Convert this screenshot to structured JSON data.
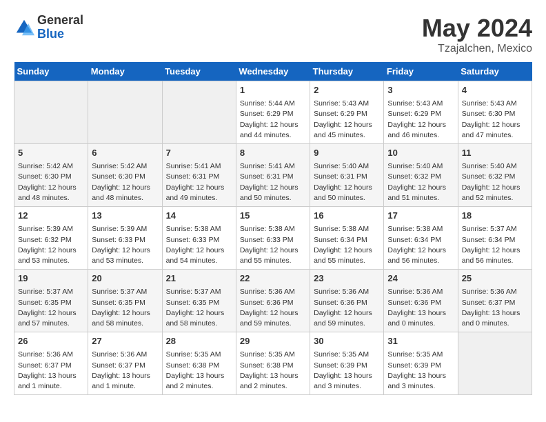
{
  "header": {
    "logo_general": "General",
    "logo_blue": "Blue",
    "month_title": "May 2024",
    "location": "Tzajalchen, Mexico"
  },
  "days_of_week": [
    "Sunday",
    "Monday",
    "Tuesday",
    "Wednesday",
    "Thursday",
    "Friday",
    "Saturday"
  ],
  "weeks": [
    [
      {
        "day": "",
        "info": ""
      },
      {
        "day": "",
        "info": ""
      },
      {
        "day": "",
        "info": ""
      },
      {
        "day": "1",
        "info": "Sunrise: 5:44 AM\nSunset: 6:29 PM\nDaylight: 12 hours\nand 44 minutes."
      },
      {
        "day": "2",
        "info": "Sunrise: 5:43 AM\nSunset: 6:29 PM\nDaylight: 12 hours\nand 45 minutes."
      },
      {
        "day": "3",
        "info": "Sunrise: 5:43 AM\nSunset: 6:29 PM\nDaylight: 12 hours\nand 46 minutes."
      },
      {
        "day": "4",
        "info": "Sunrise: 5:43 AM\nSunset: 6:30 PM\nDaylight: 12 hours\nand 47 minutes."
      }
    ],
    [
      {
        "day": "5",
        "info": "Sunrise: 5:42 AM\nSunset: 6:30 PM\nDaylight: 12 hours\nand 48 minutes."
      },
      {
        "day": "6",
        "info": "Sunrise: 5:42 AM\nSunset: 6:30 PM\nDaylight: 12 hours\nand 48 minutes."
      },
      {
        "day": "7",
        "info": "Sunrise: 5:41 AM\nSunset: 6:31 PM\nDaylight: 12 hours\nand 49 minutes."
      },
      {
        "day": "8",
        "info": "Sunrise: 5:41 AM\nSunset: 6:31 PM\nDaylight: 12 hours\nand 50 minutes."
      },
      {
        "day": "9",
        "info": "Sunrise: 5:40 AM\nSunset: 6:31 PM\nDaylight: 12 hours\nand 50 minutes."
      },
      {
        "day": "10",
        "info": "Sunrise: 5:40 AM\nSunset: 6:32 PM\nDaylight: 12 hours\nand 51 minutes."
      },
      {
        "day": "11",
        "info": "Sunrise: 5:40 AM\nSunset: 6:32 PM\nDaylight: 12 hours\nand 52 minutes."
      }
    ],
    [
      {
        "day": "12",
        "info": "Sunrise: 5:39 AM\nSunset: 6:32 PM\nDaylight: 12 hours\nand 53 minutes."
      },
      {
        "day": "13",
        "info": "Sunrise: 5:39 AM\nSunset: 6:33 PM\nDaylight: 12 hours\nand 53 minutes."
      },
      {
        "day": "14",
        "info": "Sunrise: 5:38 AM\nSunset: 6:33 PM\nDaylight: 12 hours\nand 54 minutes."
      },
      {
        "day": "15",
        "info": "Sunrise: 5:38 AM\nSunset: 6:33 PM\nDaylight: 12 hours\nand 55 minutes."
      },
      {
        "day": "16",
        "info": "Sunrise: 5:38 AM\nSunset: 6:34 PM\nDaylight: 12 hours\nand 55 minutes."
      },
      {
        "day": "17",
        "info": "Sunrise: 5:38 AM\nSunset: 6:34 PM\nDaylight: 12 hours\nand 56 minutes."
      },
      {
        "day": "18",
        "info": "Sunrise: 5:37 AM\nSunset: 6:34 PM\nDaylight: 12 hours\nand 56 minutes."
      }
    ],
    [
      {
        "day": "19",
        "info": "Sunrise: 5:37 AM\nSunset: 6:35 PM\nDaylight: 12 hours\nand 57 minutes."
      },
      {
        "day": "20",
        "info": "Sunrise: 5:37 AM\nSunset: 6:35 PM\nDaylight: 12 hours\nand 58 minutes."
      },
      {
        "day": "21",
        "info": "Sunrise: 5:37 AM\nSunset: 6:35 PM\nDaylight: 12 hours\nand 58 minutes."
      },
      {
        "day": "22",
        "info": "Sunrise: 5:36 AM\nSunset: 6:36 PM\nDaylight: 12 hours\nand 59 minutes."
      },
      {
        "day": "23",
        "info": "Sunrise: 5:36 AM\nSunset: 6:36 PM\nDaylight: 12 hours\nand 59 minutes."
      },
      {
        "day": "24",
        "info": "Sunrise: 5:36 AM\nSunset: 6:36 PM\nDaylight: 13 hours\nand 0 minutes."
      },
      {
        "day": "25",
        "info": "Sunrise: 5:36 AM\nSunset: 6:37 PM\nDaylight: 13 hours\nand 0 minutes."
      }
    ],
    [
      {
        "day": "26",
        "info": "Sunrise: 5:36 AM\nSunset: 6:37 PM\nDaylight: 13 hours\nand 1 minute."
      },
      {
        "day": "27",
        "info": "Sunrise: 5:36 AM\nSunset: 6:37 PM\nDaylight: 13 hours\nand 1 minute."
      },
      {
        "day": "28",
        "info": "Sunrise: 5:35 AM\nSunset: 6:38 PM\nDaylight: 13 hours\nand 2 minutes."
      },
      {
        "day": "29",
        "info": "Sunrise: 5:35 AM\nSunset: 6:38 PM\nDaylight: 13 hours\nand 2 minutes."
      },
      {
        "day": "30",
        "info": "Sunrise: 5:35 AM\nSunset: 6:39 PM\nDaylight: 13 hours\nand 3 minutes."
      },
      {
        "day": "31",
        "info": "Sunrise: 5:35 AM\nSunset: 6:39 PM\nDaylight: 13 hours\nand 3 minutes."
      },
      {
        "day": "",
        "info": ""
      }
    ]
  ]
}
